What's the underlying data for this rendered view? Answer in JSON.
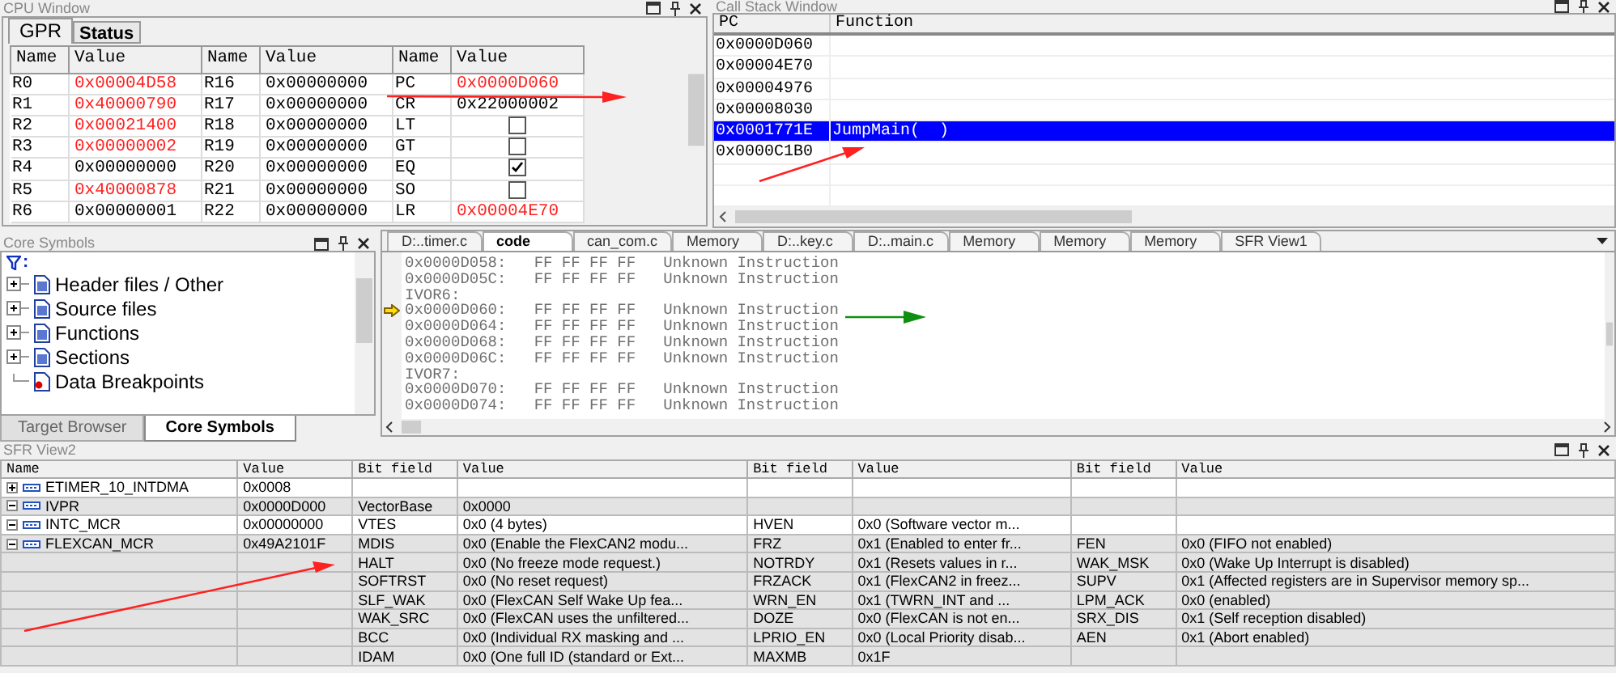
{
  "cpu_window": {
    "title": "CPU Window",
    "tabs": [
      {
        "label": "GPR",
        "selected": true
      },
      {
        "label": "Status",
        "selected": false
      }
    ],
    "columns": [
      "Name",
      "Value",
      "Name",
      "Value",
      "Name",
      "Value"
    ],
    "rows": [
      [
        "R0",
        {
          "kind": "value",
          "value": "0x00004D58",
          "changed": true
        },
        "R16",
        {
          "kind": "value",
          "value": "0x00000000",
          "changed": false
        },
        "PC",
        {
          "kind": "value",
          "value": "0x0000D060",
          "changed": true
        }
      ],
      [
        "R1",
        {
          "kind": "value",
          "value": "0x40000790",
          "changed": true
        },
        "R17",
        {
          "kind": "value",
          "value": "0x00000000",
          "changed": false
        },
        "CR",
        {
          "kind": "value",
          "value": "0x22000002",
          "changed": false
        }
      ],
      [
        "R2",
        {
          "kind": "value",
          "value": "0x00021400",
          "changed": true
        },
        "R18",
        {
          "kind": "value",
          "value": "0x00000000",
          "changed": false
        },
        "LT",
        {
          "kind": "flag",
          "checked": false
        }
      ],
      [
        "R3",
        {
          "kind": "value",
          "value": "0x00000002",
          "changed": true
        },
        "R19",
        {
          "kind": "value",
          "value": "0x00000000",
          "changed": false
        },
        "GT",
        {
          "kind": "flag",
          "checked": false
        }
      ],
      [
        "R4",
        {
          "kind": "value",
          "value": "0x00000000",
          "changed": false
        },
        "R20",
        {
          "kind": "value",
          "value": "0x00000000",
          "changed": false
        },
        "EQ",
        {
          "kind": "flag",
          "checked": true
        }
      ],
      [
        "R5",
        {
          "kind": "value",
          "value": "0x40000878",
          "changed": true
        },
        "R21",
        {
          "kind": "value",
          "value": "0x00000000",
          "changed": false
        },
        "SO",
        {
          "kind": "flag",
          "checked": false
        }
      ],
      [
        "R6",
        {
          "kind": "value",
          "value": "0x00000001",
          "changed": false
        },
        "R22",
        {
          "kind": "value",
          "value": "0x00000000",
          "changed": false
        },
        "LR",
        {
          "kind": "value",
          "value": "0x00004E70",
          "changed": true
        }
      ]
    ]
  },
  "call_stack": {
    "title": "Call Stack Window",
    "columns": [
      "PC",
      "Function"
    ],
    "rows": [
      {
        "pc": "0x0000D060",
        "selected": false
      },
      {
        "pc": "0x00004E70",
        "selected": false
      },
      {
        "pc": "0x00004976",
        "selected": false
      },
      {
        "pc": "0x00008030",
        "selected": false
      },
      {
        "pc": "0x0001771E",
        "function": "JumpMain(  )",
        "selected": true
      },
      {
        "pc": "0x0000C1B0",
        "selected": false
      }
    ]
  },
  "core_symbols": {
    "title": "Core Symbols",
    "filter_label": ":",
    "items": [
      {
        "label": "Header files / Other",
        "kind": "group",
        "expanded": false
      },
      {
        "label": "Source files",
        "kind": "group",
        "expanded": false
      },
      {
        "label": "Functions",
        "kind": "group",
        "expanded": false
      },
      {
        "label": "Sections",
        "kind": "group",
        "expanded": false
      },
      {
        "label": "Data Breakpoints",
        "kind": "item"
      }
    ],
    "tabs": [
      {
        "label": "Target Browser",
        "selected": false
      },
      {
        "label": "Core Symbols",
        "selected": true
      }
    ]
  },
  "editor": {
    "tabs": [
      {
        "label": "D:..timer.c",
        "selected": false
      },
      {
        "label": "code",
        "selected": true
      },
      {
        "label": "can_com.c",
        "selected": false
      },
      {
        "label": "Memory",
        "selected": false
      },
      {
        "label": "D:..key.c",
        "selected": false
      },
      {
        "label": "D:..main.c",
        "selected": false
      },
      {
        "label": "Memory",
        "selected": false
      },
      {
        "label": "Memory",
        "selected": false
      },
      {
        "label": "Memory",
        "selected": false
      },
      {
        "label": "SFR View1",
        "selected": false
      }
    ],
    "lines": [
      {
        "text": "0x0000D058:   FF FF FF FF   Unknown Instruction",
        "current": false
      },
      {
        "text": "0x0000D05C:   FF FF FF FF   Unknown Instruction",
        "current": false
      },
      {
        "text": "IVOR6:",
        "current": false
      },
      {
        "text": "0x0000D060:   FF FF FF FF   Unknown Instruction",
        "current": true
      },
      {
        "text": "0x0000D064:   FF FF FF FF   Unknown Instruction",
        "current": false
      },
      {
        "text": "0x0000D068:   FF FF FF FF   Unknown Instruction",
        "current": false
      },
      {
        "text": "0x0000D06C:   FF FF FF FF   Unknown Instruction",
        "current": false
      },
      {
        "text": "IVOR7:",
        "current": false
      },
      {
        "text": "0x0000D070:   FF FF FF FF   Unknown Instruction",
        "current": false
      },
      {
        "text": "0x0000D074:   FF FF FF FF   Unknown Instruction",
        "current": false
      }
    ]
  },
  "sfr_view": {
    "title": "SFR View2",
    "columns": [
      "Name",
      "Value",
      "Bit field",
      "Value",
      "Bit field",
      "Value",
      "Bit field",
      "Value"
    ],
    "rows": [
      {
        "name": "ETIMER_10_INTDMA",
        "expanded": false,
        "value": "0x0008",
        "bits": []
      },
      {
        "name": "IVPR",
        "expanded": true,
        "value": "0x0000D000",
        "bits": [
          {
            "field": "VectorBase",
            "value": "0x0000"
          }
        ]
      },
      {
        "name": "INTC_MCR",
        "expanded": true,
        "value": "0x00000000",
        "bits": [
          {
            "field": "VTES",
            "value": "0x0 (4 bytes)"
          },
          {
            "field": "HVEN",
            "value": "0x0 (Software vector m..."
          }
        ]
      },
      {
        "name": "FLEXCAN_MCR",
        "expanded": true,
        "value": "0x49A2101F",
        "bits": [
          {
            "field": "MDIS",
            "value": "0x0 (Enable the FlexCAN2 modu..."
          },
          {
            "field": "FRZ",
            "value": "0x1 (Enabled to enter fr..."
          },
          {
            "field": "FEN",
            "value": "0x0 (FIFO not enabled)"
          }
        ]
      },
      {
        "bits": [
          {
            "field": "HALT",
            "value": "0x0 (No freeze mode request.)"
          },
          {
            "field": "NOTRDY",
            "value": "0x1 (Resets values in r..."
          },
          {
            "field": "WAK_MSK",
            "value": "0x0 (Wake Up Interrupt is disabled)"
          }
        ]
      },
      {
        "bits": [
          {
            "field": "SOFTRST",
            "value": "0x0 (No reset request)"
          },
          {
            "field": "FRZACK",
            "value": "0x1 (FlexCAN2 in freez..."
          },
          {
            "field": "SUPV",
            "value": "0x1 (Affected registers are in Supervisor memory sp..."
          }
        ]
      },
      {
        "bits": [
          {
            "field": "SLF_WAK",
            "value": "0x0 (FlexCAN Self Wake Up fea..."
          },
          {
            "field": "WRN_EN",
            "value": "0x1 (TWRN_INT and ..."
          },
          {
            "field": "LPM_ACK",
            "value": "0x0 (enabled)"
          }
        ]
      },
      {
        "bits": [
          {
            "field": "WAK_SRC",
            "value": "0x0 (FlexCAN uses the unfiltered..."
          },
          {
            "field": "DOZE",
            "value": "0x0 (FlexCAN is not en..."
          },
          {
            "field": "SRX_DIS",
            "value": "0x1 (Self reception disabled)"
          }
        ]
      },
      {
        "bits": [
          {
            "field": "BCC",
            "value": "0x0 (Individual RX masking and ..."
          },
          {
            "field": "LPRIO_EN",
            "value": "0x0 (Local Priority disab..."
          },
          {
            "field": "AEN",
            "value": "0x1 (Abort enabled)"
          }
        ]
      },
      {
        "bits": [
          {
            "field": "IDAM",
            "value": "0x0 (One full ID (standard or Ext..."
          },
          {
            "field": "MAXMB",
            "value": "0x1F"
          }
        ]
      }
    ]
  }
}
